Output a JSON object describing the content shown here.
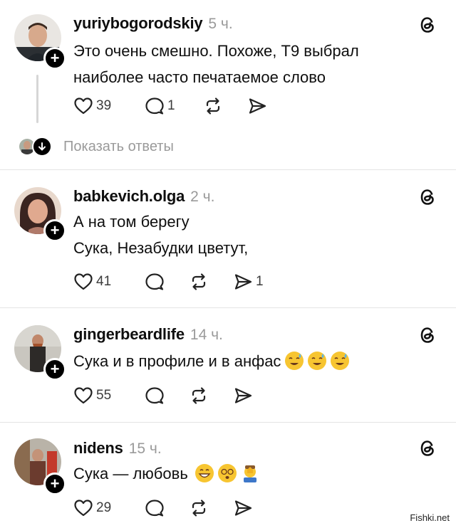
{
  "posts": [
    {
      "username": "yuriybogorodskiy",
      "time": "5 ч.",
      "lines": [
        "Это очень смешно. Похоже, Т9 выбрал",
        "наиболее часто печатаемое слово"
      ],
      "likes": "39",
      "comments": "1",
      "shares": ""
    },
    {
      "username": "babkevich.olga",
      "time": "2 ч.",
      "lines": [
        "А на том берегу",
        "Сука, Незабудки цветут,"
      ],
      "likes": "41",
      "comments": "",
      "shares": "1"
    },
    {
      "username": "gingerbeardlife",
      "time": "14 ч.",
      "lines": [
        "Сука и в профиле и в анфас"
      ],
      "likes": "55",
      "comments": "",
      "shares": ""
    },
    {
      "username": "nidens",
      "time": "15 ч.",
      "lines": [
        "Сука — любовь"
      ],
      "likes": "29",
      "comments": "",
      "shares": ""
    }
  ],
  "show_replies": "Показать ответы",
  "watermark": "Fishki.net",
  "icons": {
    "follow": "plus-icon",
    "threads": "threads-logo-icon",
    "like": "heart-icon",
    "comment": "comment-icon",
    "repost": "repost-icon",
    "share": "send-icon"
  }
}
